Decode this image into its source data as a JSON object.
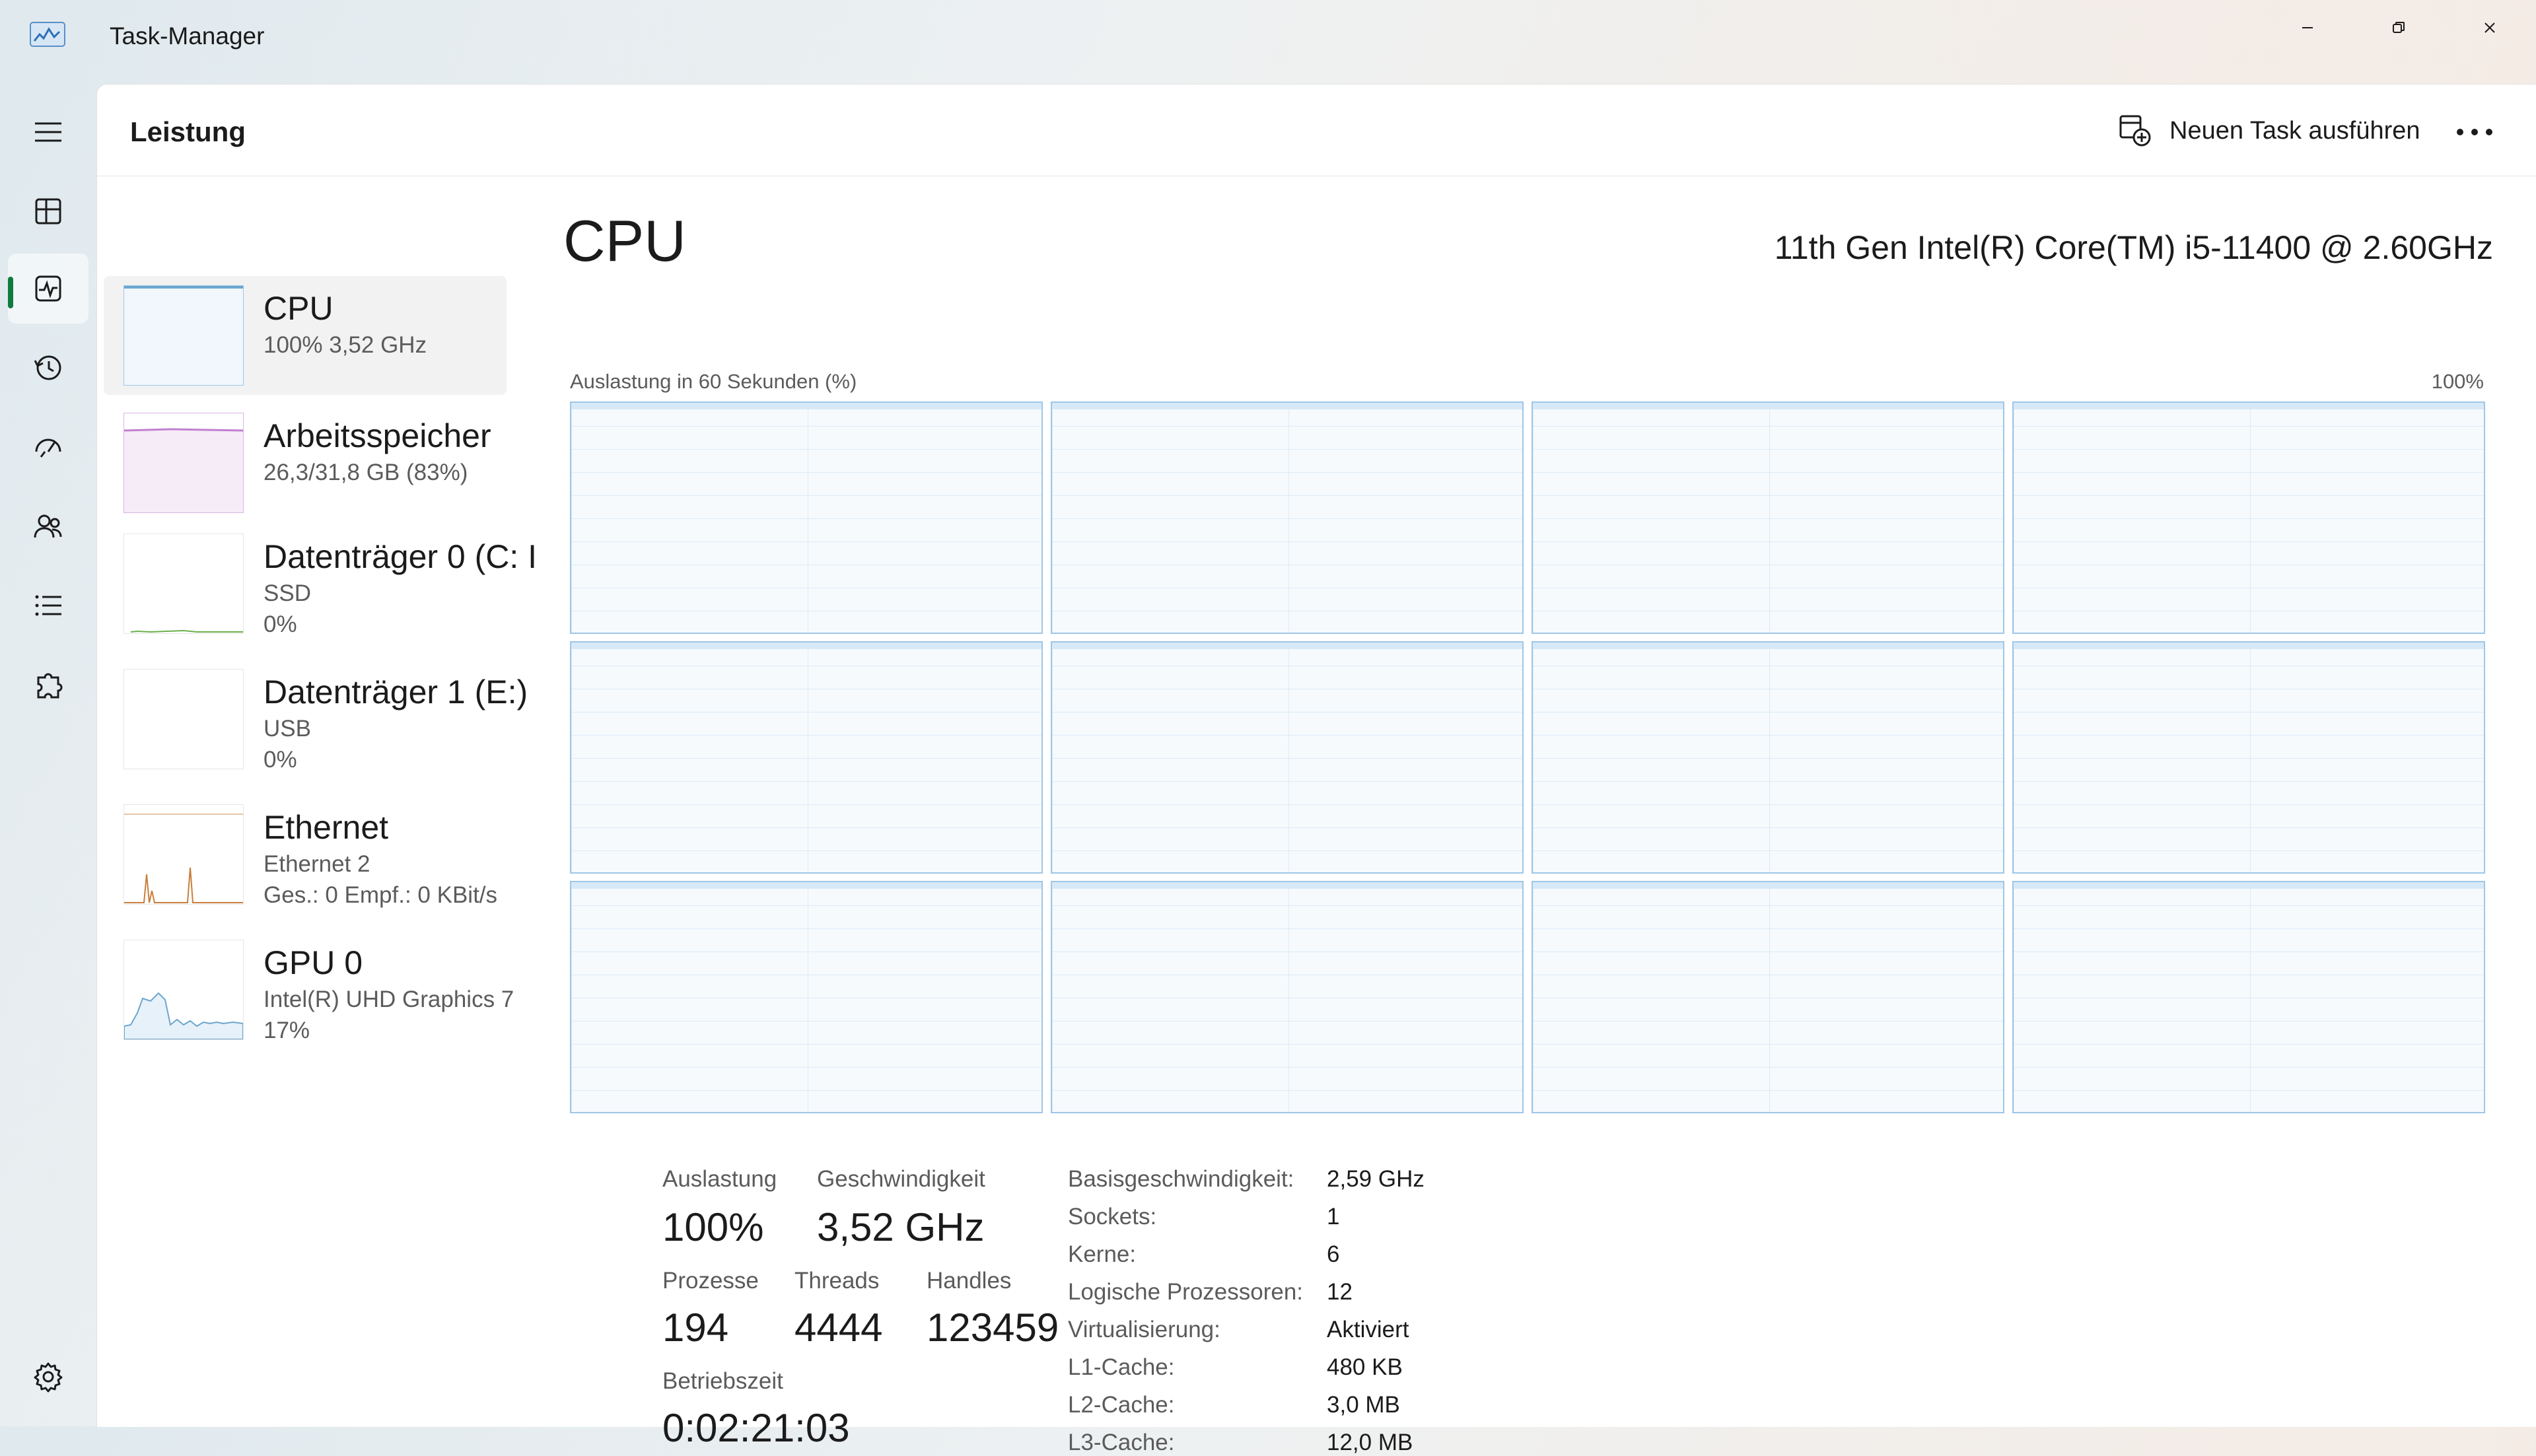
{
  "window": {
    "title": "Task-Manager"
  },
  "header": {
    "page_title": "Leistung",
    "run_task_label": "Neuen Task ausführen"
  },
  "sidebar": {
    "items": [
      {
        "name": "CPU",
        "sub": "100%  3,52 GHz"
      },
      {
        "name": "Arbeitsspeicher",
        "sub": "26,3/31,8 GB (83%)"
      },
      {
        "name": "Datenträger 0 (C: I",
        "sub1": "SSD",
        "sub2": "0%"
      },
      {
        "name": "Datenträger 1 (E:)",
        "sub1": "USB",
        "sub2": "0%"
      },
      {
        "name": "Ethernet",
        "sub1": "Ethernet 2",
        "sub2": "Ges.: 0  Empf.: 0 KBit/s"
      },
      {
        "name": "GPU 0",
        "sub1": "Intel(R) UHD Graphics 7",
        "sub2": "17%"
      }
    ]
  },
  "main": {
    "title": "CPU",
    "model": "11th Gen Intel(R) Core(TM) i5-11400 @ 2.60GHz",
    "graph_label": "Auslastung in 60 Sekunden (%)",
    "graph_max": "100%",
    "core_count": 12
  },
  "stats": {
    "auslastung_label": "Auslastung",
    "auslastung": "100%",
    "geschwindigkeit_label": "Geschwindigkeit",
    "geschwindigkeit": "3,52 GHz",
    "prozesse_label": "Prozesse",
    "prozesse": "194",
    "threads_label": "Threads",
    "threads": "4444",
    "handles_label": "Handles",
    "handles": "123459",
    "betriebszeit_label": "Betriebszeit",
    "betriebszeit": "0:02:21:03"
  },
  "details": [
    {
      "label": "Basisgeschwindigkeit:",
      "value": "2,59 GHz"
    },
    {
      "label": "Sockets:",
      "value": "1"
    },
    {
      "label": "Kerne:",
      "value": "6"
    },
    {
      "label": "Logische Prozessoren:",
      "value": "12"
    },
    {
      "label": "Virtualisierung:",
      "value": "Aktiviert"
    },
    {
      "label": "L1-Cache:",
      "value": "480 KB"
    },
    {
      "label": "L2-Cache:",
      "value": "3,0 MB"
    },
    {
      "label": "L3-Cache:",
      "value": "12,0 MB"
    }
  ],
  "colors": {
    "cpu": "#9fc6e6",
    "memory": "#c27fd1",
    "disk": "#6ab04c",
    "ethernet": "#c87f3c",
    "gpu": "#6ba6cf",
    "nav_active": "#0f7b3f"
  }
}
